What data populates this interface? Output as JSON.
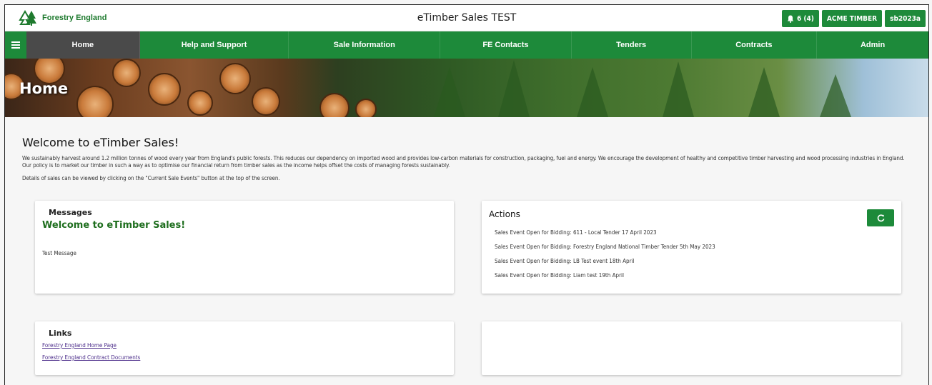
{
  "header": {
    "brand": "Forestry England",
    "app_title": "eTimber Sales TEST",
    "notifications_label": "6 (4)",
    "company_label": "ACME TIMBER",
    "user_label": "sb2023a",
    "brand_color": "#1d8a3a"
  },
  "nav": {
    "items": [
      {
        "label": "Home",
        "active": true
      },
      {
        "label": "Help and Support"
      },
      {
        "label": "Sale Information"
      },
      {
        "label": "FE Contacts"
      },
      {
        "label": "Tenders"
      },
      {
        "label": "Contracts"
      },
      {
        "label": "Admin"
      }
    ]
  },
  "banner": {
    "title": "Home"
  },
  "main": {
    "welcome_title": "Welcome to eTimber Sales!",
    "intro_text": "We sustainably harvest around 1.2 million tonnes of wood every year from England's public forests. This reduces our dependency on imported wood and provides low-carbon materials for construction, packaging, fuel and energy. We encourage the development of healthy and competitive timber harvesting and wood processing industries in England. Our policy is to market our timber in such a way as to optimise our financial return from timber sales as the income helps offset the costs of managing forests sustainably.",
    "details_text": "Details of sales can be viewed by clicking on the \"Current Sale Events\" button at the top of the screen."
  },
  "messages": {
    "heading": "Messages",
    "title": "Welcome to eTimber Sales!",
    "body": "Test Message"
  },
  "actions": {
    "heading": "Actions",
    "refresh_icon": "refresh-icon",
    "items": [
      "Sales Event Open for Bidding: 611 - Local Tender 17 April 2023",
      "Sales Event Open for Bidding: Forestry England National Timber Tender 5th May 2023",
      "Sales Event Open for Bidding: LB Test event 18th April",
      "Sales Event Open for Bidding: Liam test 19th April"
    ]
  },
  "links": {
    "heading": "Links",
    "items": [
      "Forestry England Home Page",
      "Forestry England Contract Documents"
    ]
  }
}
